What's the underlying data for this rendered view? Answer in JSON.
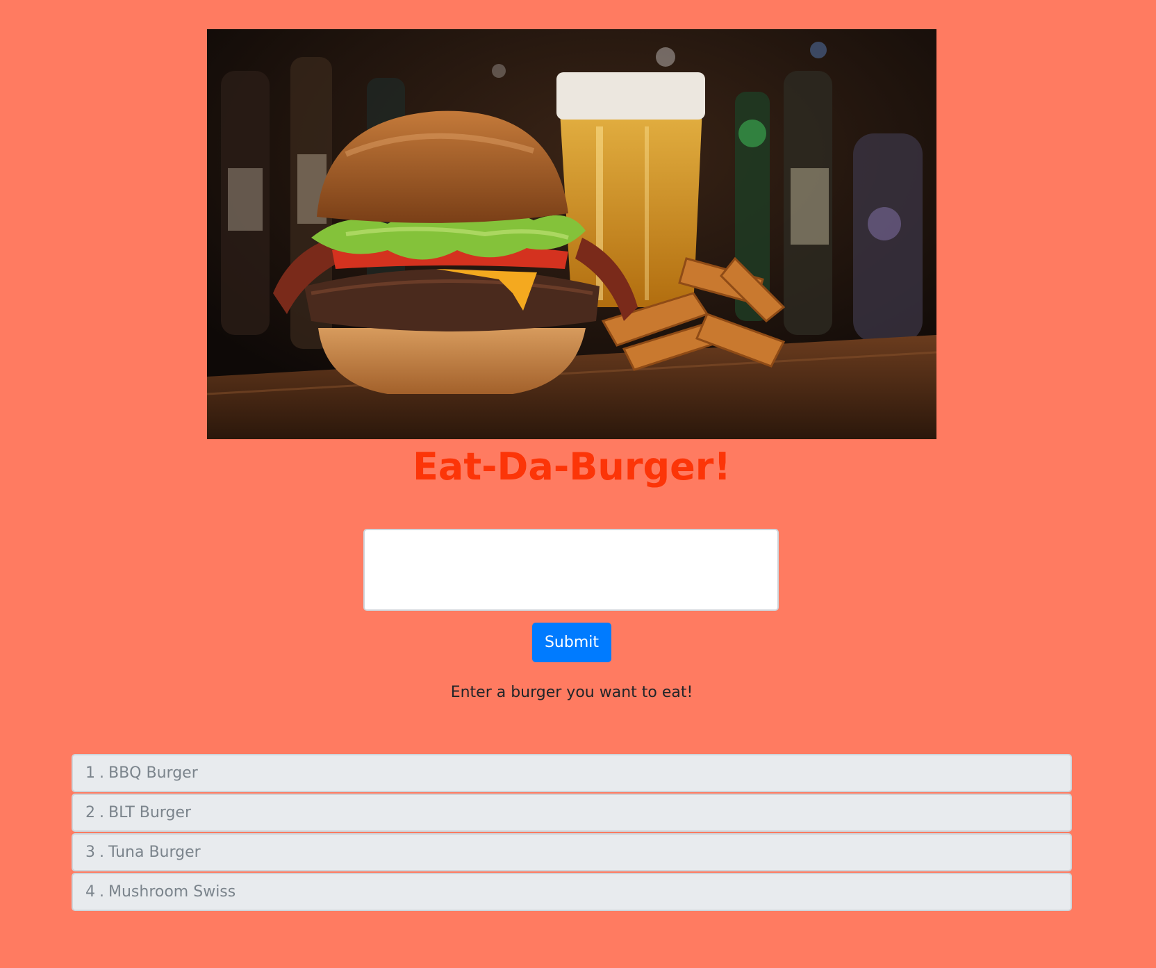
{
  "hero": {
    "image_alt": "Burger with beer and waffle fries"
  },
  "page": {
    "title": "Eat-Da-Burger!"
  },
  "form": {
    "input_value": "",
    "submit_label": "Submit",
    "helper_text": "Enter a burger you want to eat!"
  },
  "burgers": [
    {
      "number": "1",
      "separator": ".",
      "name": "BBQ Burger"
    },
    {
      "number": "2",
      "separator": ".",
      "name": "BLT Burger"
    },
    {
      "number": "3",
      "separator": ".",
      "name": "Tuna Burger"
    },
    {
      "number": "4",
      "separator": ".",
      "name": "Mushroom Swiss"
    }
  ],
  "colors": {
    "background": "#ff7b61",
    "title": "#fc3508",
    "button": "#007bff",
    "list_item_bg": "#e8ebee"
  }
}
